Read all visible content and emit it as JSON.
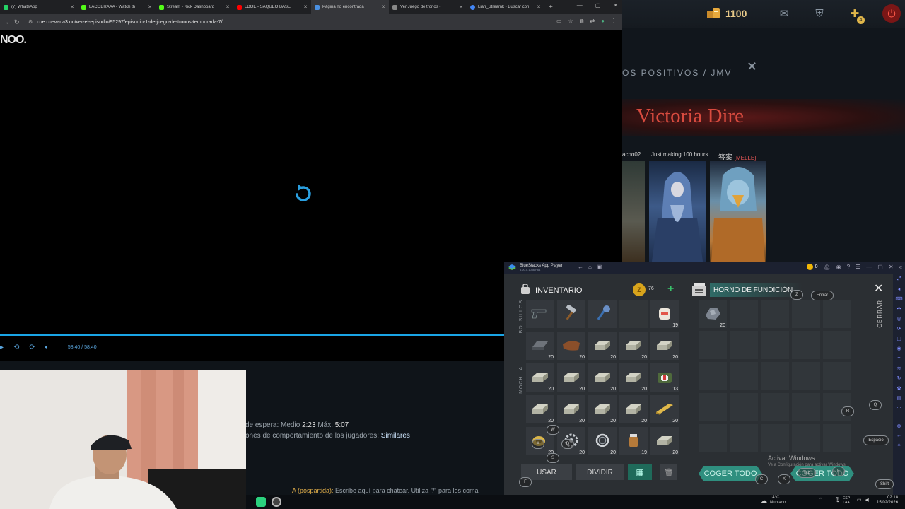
{
  "browser": {
    "tabs": [
      {
        "label": "(7) WhatsApp",
        "color": "#25d366",
        "active": false
      },
      {
        "label": "LACOBRAAA - Watch th",
        "color": "#53fc18",
        "active": false
      },
      {
        "label": "Stream - Kick Dashboard",
        "color": "#53fc18",
        "active": false
      },
      {
        "label": "LDOE - SAQUEO BASE",
        "color": "#ff0000",
        "active": false
      },
      {
        "label": "Página no encontrada",
        "color": "#4a90e2",
        "active": true
      },
      {
        "label": "Ver Juego de tronos - T",
        "color": "#888888",
        "active": false
      },
      {
        "label": "Lian_Streamk - Buscar con",
        "color": "#4285f4",
        "active": false
      }
    ],
    "new_tab": "+",
    "url": "cue.cuevana3.nu/ver-el-episodio/95297/episodio-1-de-juego-de-tronos-temporada-7/",
    "video_label": "NOO.",
    "time_display": "58:40 / 58:40",
    "wait_label": "de espera: Medio",
    "wait_avg": "2:23",
    "wait_max_label": "Máx.",
    "wait_max": "5:07",
    "behavior_text": "ones de comportamiento de los jugadores:",
    "behavior_link": "Similares",
    "chat_who": "A (posparti­da):",
    "chat_hint": "Escribe aquí para chatear. Utiliza \"/\" para los coma"
  },
  "game": {
    "gold": "1100",
    "party_label": "OS POSITIVOS / JMV",
    "victory": "Victoria Dire",
    "players": [
      {
        "name": "acho02"
      },
      {
        "name": "Just making 100 hours"
      },
      {
        "name": "答案",
        "tag": "[MELLE]"
      }
    ],
    "icons": [
      "mail-icon",
      "armory-icon",
      "plus-badge-icon",
      "power-icon"
    ],
    "badge_count": "4"
  },
  "bluestacks": {
    "title": "BlueStacks App Player",
    "subtitle": "5.20.0.1036  P64",
    "coin_count": "0",
    "inventory_title": "INVENTARIO",
    "coin_value": "76",
    "pockets_label": "BOLSILLOS",
    "backpack_label": "MOCHILA",
    "pockets": [
      {
        "item": "pistol",
        "qty": ""
      },
      {
        "item": "hammer",
        "qty": ""
      },
      {
        "item": "mace",
        "qty": ""
      },
      {
        "item": "",
        "qty": ""
      },
      {
        "item": "bandage",
        "qty": "19"
      },
      {
        "item": "iron-bar",
        "qty": "20"
      },
      {
        "item": "leather",
        "qty": "20"
      },
      {
        "item": "brick",
        "qty": "20"
      },
      {
        "item": "brick",
        "qty": "20"
      },
      {
        "item": "brick",
        "qty": "20"
      }
    ],
    "backpack": [
      {
        "item": "brick",
        "qty": "20"
      },
      {
        "item": "brick",
        "qty": "20"
      },
      {
        "item": "brick",
        "qty": "20"
      },
      {
        "item": "brick",
        "qty": "20"
      },
      {
        "item": "medkit",
        "qty": "13"
      },
      {
        "item": "brick",
        "qty": "20"
      },
      {
        "item": "brick",
        "qty": "20"
      },
      {
        "item": "brick",
        "qty": "20"
      },
      {
        "item": "brick",
        "qty": "20"
      },
      {
        "item": "plank",
        "qty": "20"
      },
      {
        "item": "rope",
        "qty": "20"
      },
      {
        "item": "gear",
        "qty": "20"
      },
      {
        "item": "ring",
        "qty": "20"
      },
      {
        "item": "jar",
        "qty": "19"
      },
      {
        "item": "brick",
        "qty": "20"
      }
    ],
    "use_label": "USAR",
    "split_label": "DIVIDIR",
    "furnace_title": "HORNO DE FUNDICIÓN",
    "close_label": "CERRAR",
    "furnace_slot_qty": "20",
    "take_all_label": "COGER TODO",
    "take_all_label2": "COGER TODO",
    "keys": {
      "z": "Z",
      "enter": "Entrar",
      "r": "R",
      "q": "Q",
      "space": "Espacio",
      "shift": "Shift",
      "w": "W",
      "a": "A",
      "s": "S",
      "d": "D",
      "f": "F",
      "c": "C",
      "x": "X",
      "tab": "Tab",
      "e": "E"
    },
    "activate_windows": "Activar Windows",
    "activate_sub": "Ve a Configuración para activar Windows."
  },
  "taskbar": {
    "temp": "14°C",
    "weather": "Nublado",
    "lang_top": "ESP",
    "lang_bottom": "LAA",
    "time": "02:18",
    "date": "15/02/2026"
  },
  "colors": {
    "accent": "#1aa5e6",
    "victory": "#d84b3f",
    "take_button": "#2f8f7f"
  }
}
